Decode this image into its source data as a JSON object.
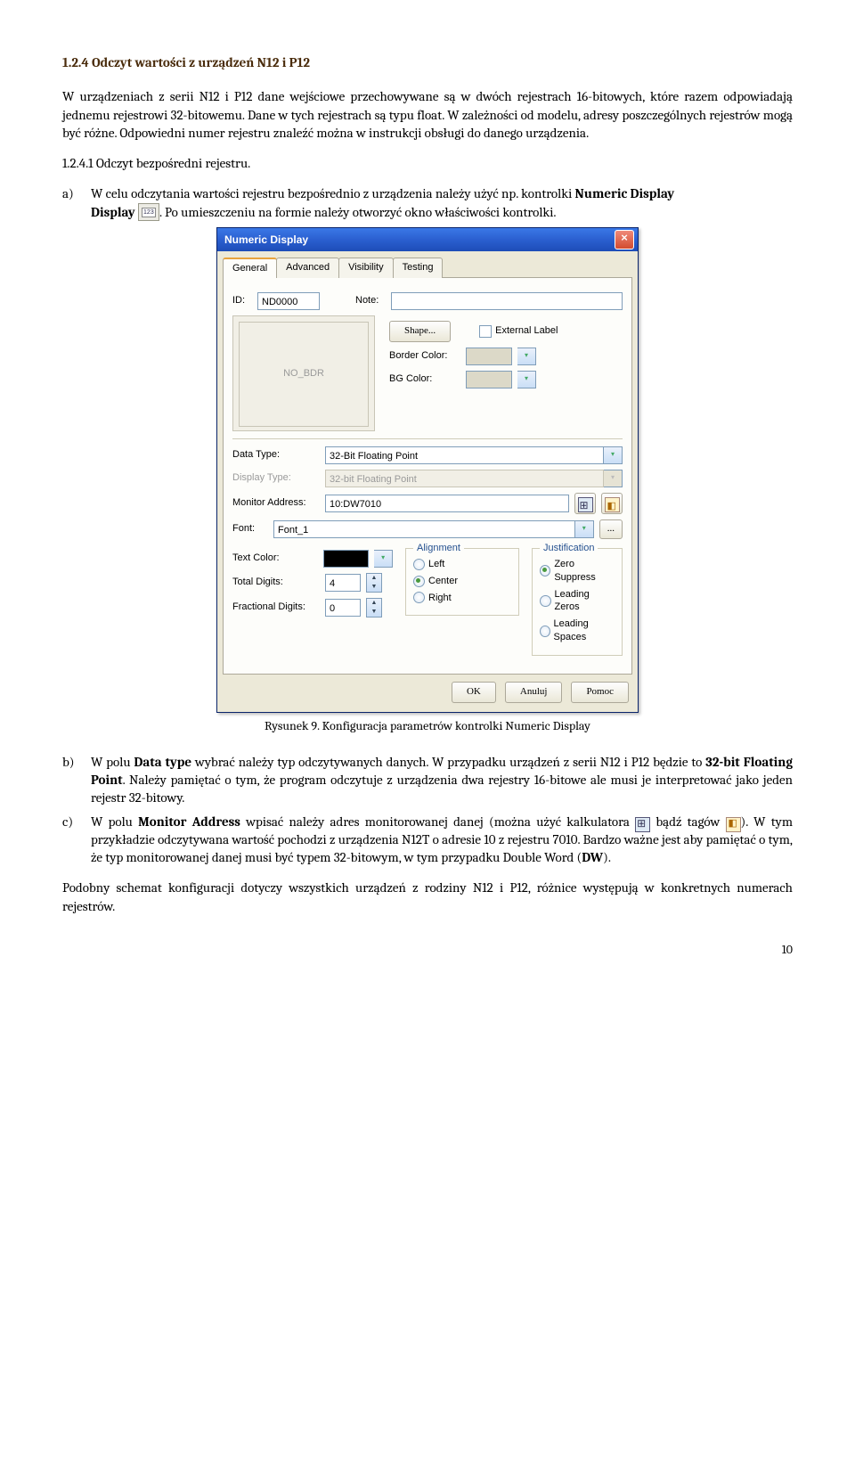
{
  "section_heading": "1.2.4 Odczyt wartości z urządzeń N12 i P12",
  "para1": "W urządzeniach z serii N12 i P12 dane wejściowe przechowywane są w dwóch rejestrach 16-bitowych, które razem odpowiadają jednemu rejestrowi 32-bitowemu. Dane w tych rejestrach są typu float. W zależności od modelu, adresy poszczególnych rejestrów mogą być różne. Odpowiedni numer rejestru znaleźć można w instrukcji obsługi do danego urządzenia.",
  "sub1_heading": "1.2.4.1 Odczyt bezpośredni rejestru.",
  "item_a": {
    "marker": "a)",
    "text1_before": "W celu odczytania wartości rejestru bezpośrednio z urządzenia należy użyć np. kontrolki ",
    "bold1": "Numeric Display",
    "text1_after": ". Po umieszczeniu na formie należy otworzyć okno właściwości kontrolki."
  },
  "caption": "Rysunek 9. Konfiguracja parametrów kontrolki Numeric Display",
  "item_b": {
    "marker": "b)",
    "before1": "W polu ",
    "bold1": "Data type",
    "mid1": " wybrać należy typ odczytywanych danych. W przypadku urządzeń z serii N12 i P12 będzie to ",
    "bold2": "32-bit Floating Point",
    "after1": ". Należy pamiętać o tym, że program odczytuje z urządzenia dwa rejestry 16-bitowe ale musi je interpretować jako jeden rejestr 32-bitowy."
  },
  "item_c": {
    "marker": "c)",
    "before1": "W polu ",
    "bold1": "Monitor Address",
    "mid1": " wpisać należy adres monitorowanej danej (można użyć kalkulatora ",
    "mid2": " bądź tagów ",
    "mid3": "). W tym przykładzie odczytywana wartość pochodzi z urządzenia N12T o adresie 10 z rejestru 7010. Bardzo ważne jest aby pamiętać o tym, że typ monitorowanej danej musi być typem 32-bitowym, w tym przypadku Double Word (",
    "bold2": "DW",
    "after1": ")."
  },
  "para_last": "Podobny schemat konfiguracji dotyczy wszystkich urządzeń z rodziny N12 i P12, różnice występują w konkretnych numerach rejestrów.",
  "page_number": "10",
  "dialog": {
    "title": "Numeric Display",
    "tabs": [
      "General",
      "Advanced",
      "Visibility",
      "Testing"
    ],
    "id_label": "ID:",
    "id_value": "ND0000",
    "note_label": "Note:",
    "note_value": "",
    "shape_btn": "Shape...",
    "external_label": "External Label",
    "border_color_label": "Border Color:",
    "bg_color_label": "BG Color:",
    "no_bdr": "NO_BDR",
    "data_type_label": "Data Type:",
    "data_type_value": "32-Bit Floating Point",
    "display_type_label": "Display Type:",
    "display_type_value": "32-bit Floating Point",
    "monitor_label": "Monitor Address:",
    "monitor_value": "10:DW7010",
    "font_label": "Font:",
    "font_value": "Font_1",
    "text_color_label": "Text Color:",
    "total_digits_label": "Total Digits:",
    "total_digits_value": "4",
    "frac_digits_label": "Fractional Digits:",
    "frac_digits_value": "0",
    "alignment_legend": "Alignment",
    "align_left": "Left",
    "align_center": "Center",
    "align_right": "Right",
    "just_legend": "Justification",
    "just_zero": "Zero Suppress",
    "just_lzero": "Leading Zeros",
    "just_lspace": "Leading Spaces",
    "ok": "OK",
    "cancel": "Anuluj",
    "help": "Pomoc"
  }
}
